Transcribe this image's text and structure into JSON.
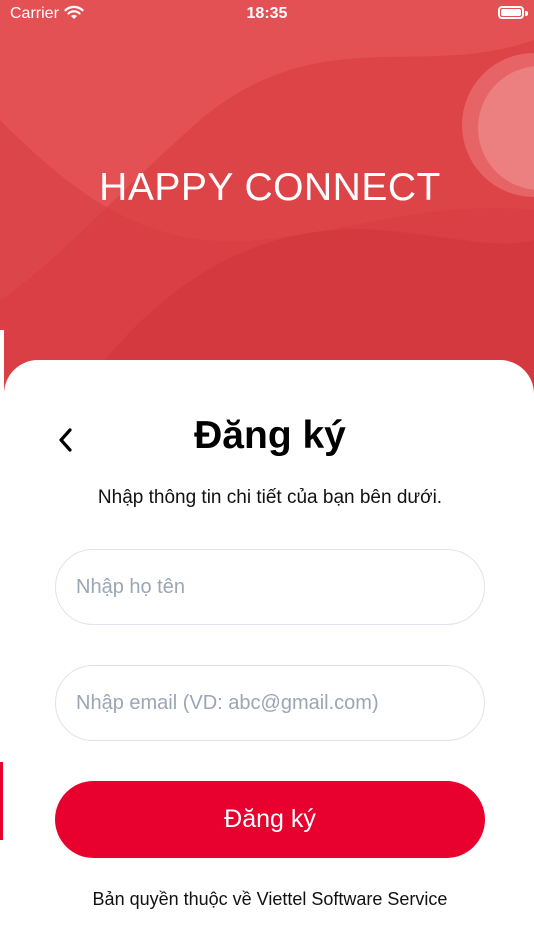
{
  "status_bar": {
    "carrier": "Carrier",
    "time": "18:35"
  },
  "app_title": "HAPPY CONNECT",
  "screen": {
    "title": "Đăng ký",
    "subtitle": "Nhập thông tin chi tiết của bạn bên dưới.",
    "name_placeholder": "Nhập họ tên",
    "email_placeholder": "Nhập email (VD: abc@gmail.com)",
    "submit_label": "Đăng ký",
    "copyright": "Bản quyền thuộc về Viettel Software Service"
  },
  "colors": {
    "hero_red": "#dd4448",
    "accent": "#e8002f",
    "field_border": "#dfe3ea",
    "placeholder": "#9aa6b6"
  }
}
